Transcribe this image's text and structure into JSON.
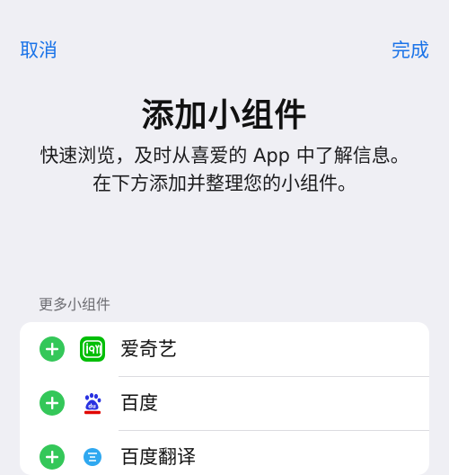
{
  "nav": {
    "cancel_label": "取消",
    "done_label": "完成"
  },
  "header": {
    "title": "添加小组件",
    "subtitle": "快速浏览，及时从喜爱的 App 中了解信息。在下方添加并整理您的小组件。"
  },
  "section": {
    "title": "更多小组件",
    "items": [
      {
        "name": "爱奇艺",
        "icon": "iqiyi-icon"
      },
      {
        "name": "百度",
        "icon": "baidu-icon"
      },
      {
        "name": "百度翻译",
        "icon": "baidu-translate-icon"
      }
    ]
  },
  "colors": {
    "accent": "#1a73e8",
    "add_green": "#34c759",
    "background": "#efeff4"
  }
}
